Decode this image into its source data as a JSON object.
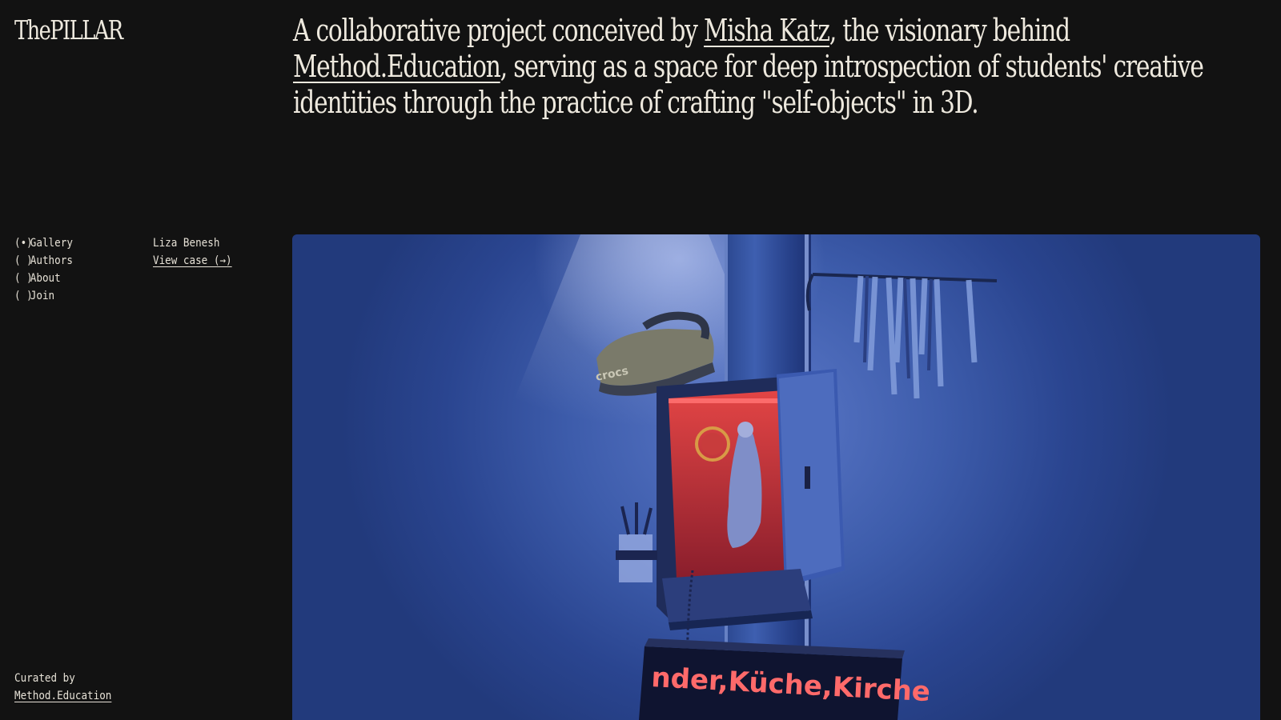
{
  "site": {
    "logo": "ThePILLAR"
  },
  "intro": {
    "text_1": "A collaborative project conceived by ",
    "link_author": "Misha Katz",
    "text_2": ", the visionary behind ",
    "link_org": "Method.Education",
    "text_3": ", serving as a space for deep introspection of students' creative identities through the practice of crafting \"self-objects\" in 3D."
  },
  "nav": {
    "items": [
      {
        "radio": "(•)",
        "label": "Gallery",
        "selected": true
      },
      {
        "radio": "( )",
        "label": "Authors",
        "selected": false
      },
      {
        "radio": "( )",
        "label": "About",
        "selected": false
      },
      {
        "radio": "( )",
        "label": "Join",
        "selected": false
      }
    ]
  },
  "current_case": {
    "author": "Liza Benesh",
    "view_link": "View case (→)"
  },
  "footer": {
    "curated_label": "Curated by",
    "curated_link": "Method.Education"
  },
  "hero": {
    "sign_text": "nder,Küche,Kirche",
    "shoe_text": "crocs"
  },
  "colors": {
    "background": "#121212",
    "text": "#eee9de",
    "hero_blue": "#3d5cab",
    "shrine_red": "#d23a3a",
    "led_red": "#ff5c5c"
  }
}
